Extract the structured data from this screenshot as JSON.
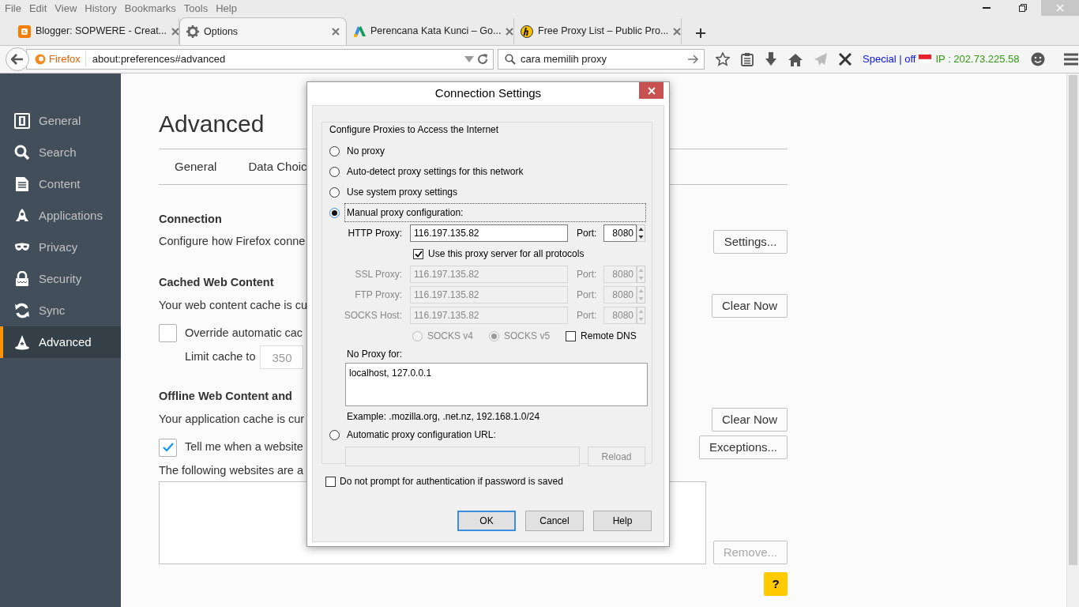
{
  "menu_bar": [
    "File",
    "Edit",
    "View",
    "History",
    "Bookmarks",
    "Tools",
    "Help"
  ],
  "tabs": [
    {
      "title": "Blogger: SOPWERE - Creat...",
      "selected": false
    },
    {
      "title": "Options",
      "selected": true
    },
    {
      "title": "Perencana Kata Kunci – Go...",
      "selected": false
    },
    {
      "title": "Free Proxy List – Public Pro...",
      "selected": false
    }
  ],
  "address_bar": {
    "identity": "Firefox",
    "url": "about:preferences#advanced"
  },
  "search_bar": {
    "value": "cara memilih proxy"
  },
  "toolbar_status": {
    "mode": "Special | off",
    "ip": "IP : 202.73.225.58"
  },
  "sidebar": {
    "items": [
      {
        "label": "General",
        "selected": false
      },
      {
        "label": "Search",
        "selected": false
      },
      {
        "label": "Content",
        "selected": false
      },
      {
        "label": "Applications",
        "selected": false
      },
      {
        "label": "Privacy",
        "selected": false
      },
      {
        "label": "Security",
        "selected": false
      },
      {
        "label": "Sync",
        "selected": false
      },
      {
        "label": "Advanced",
        "selected": true
      }
    ]
  },
  "page": {
    "title": "Advanced",
    "subtabs": [
      {
        "label": "General",
        "selected": false
      },
      {
        "label": "Data Choic",
        "selected": false
      }
    ],
    "connection": {
      "heading": "Connection",
      "text": "Configure how Firefox conne",
      "button": "Settings..."
    },
    "cache": {
      "heading": "Cached Web Content",
      "text": "Your web content cache is cu",
      "button": "Clear Now",
      "override": {
        "label": "Override automatic cac",
        "checked": false
      },
      "limit_label": "Limit cache to",
      "limit_value": "350"
    },
    "offline": {
      "heading": "Offline Web Content and",
      "text": "Your application cache is cur",
      "button": "Clear Now",
      "notify": {
        "label": "Tell me when a website",
        "checked": true
      },
      "exceptions": "Exceptions...",
      "list_text": "The following websites are a",
      "remove": {
        "label": "Remove...",
        "disabled": true
      }
    },
    "help": "?"
  },
  "dialog": {
    "title": "Connection Settings",
    "group_title": "Configure Proxies to Access the Internet",
    "proxy_modes": [
      {
        "label": "No proxy",
        "selected": false
      },
      {
        "label": "Auto-detect proxy settings for this network",
        "selected": false
      },
      {
        "label": "Use system proxy settings",
        "selected": false
      },
      {
        "label": "Manual proxy configuration:",
        "selected": true
      },
      {
        "label": "Automatic proxy configuration URL:",
        "selected": false
      }
    ],
    "proxies": [
      {
        "label": "HTTP Proxy:",
        "value": "116.197.135.82",
        "port_label": "Port:",
        "port": "8080",
        "disabled": false
      },
      {
        "label": "SSL Proxy:",
        "value": "116.197.135.82",
        "port_label": "Port:",
        "port": "8080",
        "disabled": true
      },
      {
        "label": "FTP Proxy:",
        "value": "116.197.135.82",
        "port_label": "Port:",
        "port": "8080",
        "disabled": true
      },
      {
        "label": "SOCKS Host:",
        "value": "116.197.135.82",
        "port_label": "Port:",
        "port": "8080",
        "disabled": true
      }
    ],
    "share_all": {
      "label": "Use this proxy server for all protocols",
      "checked": true
    },
    "socks_versions": [
      {
        "label": "SOCKS v4",
        "selected": false
      },
      {
        "label": "SOCKS v5",
        "selected": true
      }
    ],
    "socks_disabled": true,
    "remote_dns": {
      "label": "Remote DNS",
      "checked": false
    },
    "no_proxy_label": "No Proxy for:",
    "no_proxy_value": "localhost, 127.0.0.1",
    "example": "Example: .mozilla.org, .net.nz, 192.168.1.0/24",
    "reload": {
      "label": "Reload",
      "disabled": true
    },
    "auth": {
      "label": "Do not prompt for authentication if password is saved",
      "checked": false
    },
    "buttons": [
      {
        "label": "OK",
        "default": true
      },
      {
        "label": "Cancel",
        "default": false
      },
      {
        "label": "Help",
        "default": false
      }
    ]
  }
}
